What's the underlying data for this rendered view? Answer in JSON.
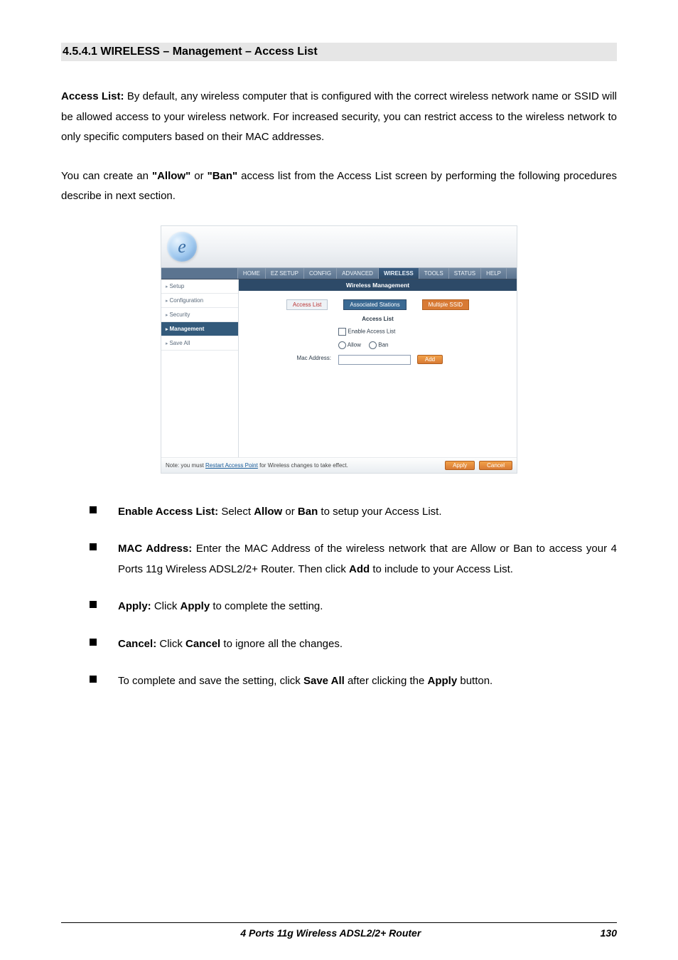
{
  "section_heading": "4.5.4.1 WIRELESS – Management – Access List",
  "para1": {
    "lead": "Access List:",
    "rest": " By default, any wireless computer that is configured with the correct wireless network name or SSID will be allowed access to your wireless network. For increased security, you can restrict access to the wireless network to only specific computers based on their MAC addresses."
  },
  "para2": {
    "pre": "You can create an ",
    "allow": "\"Allow\"",
    "mid1": " or ",
    "ban": "\"Ban\"",
    "mid2": " access list from the Access List screen by performing the following procedures describe in next section."
  },
  "router": {
    "logo_letter": "e",
    "top_tabs": [
      "HOME",
      "EZ SETUP",
      "CONFIG",
      "ADVANCED",
      "WIRELESS",
      "TOOLS",
      "STATUS",
      "HELP"
    ],
    "top_active_index": 4,
    "side_items": [
      "Setup",
      "Configuration",
      "Security",
      "Management",
      "Save All"
    ],
    "side_active_index": 3,
    "banner": "Wireless Management",
    "subtabs": [
      {
        "label": "Access List",
        "style": "red"
      },
      {
        "label": "Associated Stations",
        "style": "blue"
      },
      {
        "label": "Multiple SSID",
        "style": "orange"
      }
    ],
    "panel_title": "Access List",
    "enable_label": "Enable Access List",
    "radio_allow": "Allow",
    "radio_ban": "Ban",
    "mac_label": "Mac Address:",
    "add_btn": "Add",
    "footer_note_pre": "Note: you must ",
    "footer_note_link": "Restart Access Point",
    "footer_note_post": " for Wireless changes to take effect.",
    "apply_btn": "Apply",
    "cancel_btn": "Cancel"
  },
  "bullets": {
    "b1": {
      "lead": "Enable Access List:",
      "mid": " Select ",
      "s1": "Allow",
      "or": " or ",
      "s2": "Ban",
      "tail": " to setup your Access List."
    },
    "b2": {
      "lead": "MAC Address:",
      "mid": " Enter the MAC Address of the wireless network that are Allow or Ban to access your 4 Ports 11g Wireless ADSL2/2+ Router. Then click ",
      "s1": "Add",
      "tail": " to include to your Access List."
    },
    "b3": {
      "lead": "Apply:",
      "mid": " Click ",
      "s1": "Apply",
      "tail": " to complete the setting."
    },
    "b4": {
      "lead": "Cancel:",
      "mid": " Click ",
      "s1": "Cancel",
      "tail": " to ignore all the changes."
    },
    "b5": {
      "pre": "To complete and save the setting, click ",
      "s1": "Save All",
      "mid": " after clicking the ",
      "s2": "Apply",
      "tail": " button."
    }
  },
  "doc_footer_title": "4 Ports 11g Wireless ADSL2/2+ Router",
  "doc_footer_page": "130"
}
